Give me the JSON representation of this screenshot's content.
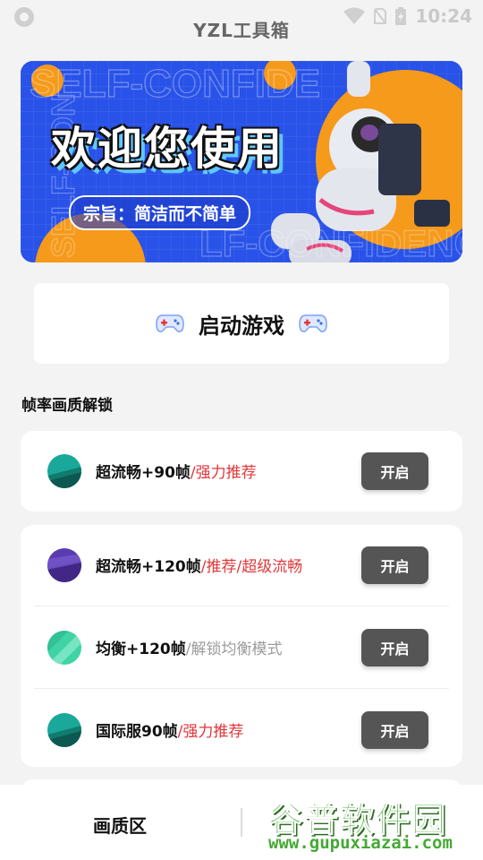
{
  "status_bar": {
    "time": "10:24"
  },
  "app": {
    "title": "YZL工具箱"
  },
  "banner": {
    "headline": "欢迎您使用",
    "tagline": "宗旨：简洁而不简单",
    "background_text_1": "SELF-CONFIDE",
    "background_text_2": "SELF-CON",
    "background_text_3": "LF-CONFIDENC"
  },
  "launch": {
    "label": "启动游戏"
  },
  "section": {
    "title": "帧率画质解锁"
  },
  "options": [
    {
      "main": "超流畅+90帧",
      "sub": "/强力推荐",
      "sub_color": "red",
      "button": "开启",
      "icon_color": "#1aa89a"
    },
    {
      "main": "超流畅+120帧",
      "sub": "/推荐/超级流畅",
      "sub_color": "red",
      "button": "开启",
      "icon_color": "#5b3bb0"
    },
    {
      "main": "均衡+120帧",
      "sub": "/解锁均衡模式",
      "sub_color": "grey",
      "button": "开启",
      "icon_color": "#3fd3a6"
    },
    {
      "main": "国际服90帧",
      "sub": "/强力推荐",
      "sub_color": "red",
      "button": "开启",
      "icon_color": "#1aa89a"
    }
  ],
  "bottom_nav": {
    "tab_1": "画质区"
  },
  "watermark": {
    "logo": "谷普软件园",
    "url": "www.gupuxiazai.com"
  },
  "colors": {
    "accent_red": "#e0373a",
    "button_dark": "#555555",
    "banner_blue": "#2852e8",
    "orange": "#f59a1b"
  }
}
